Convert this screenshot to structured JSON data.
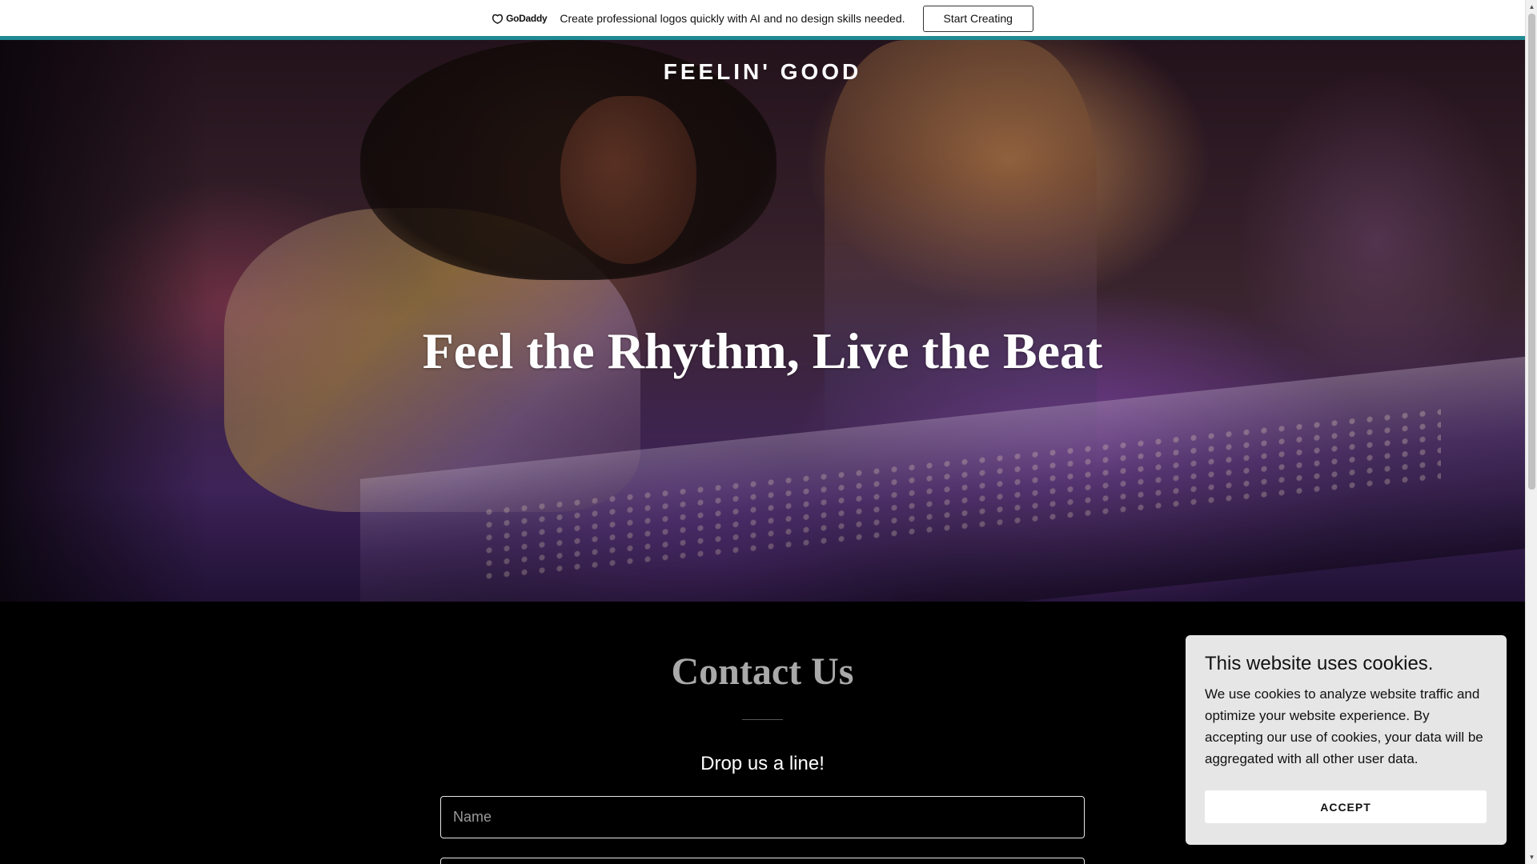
{
  "promo": {
    "logo_text": "GoDaddy",
    "text": "Create professional logos quickly with AI and no design skills needed.",
    "button_label": "Start Creating",
    "accent_color": "#1f8a93"
  },
  "site": {
    "title": "FEELIN' GOOD"
  },
  "hero": {
    "heading": "Feel the Rhythm, Live the Beat"
  },
  "contact": {
    "heading": "Contact Us",
    "subheading": "Drop us a line!",
    "name_placeholder": "Name",
    "email_placeholder": ""
  },
  "cookie": {
    "title": "This website uses cookies.",
    "body": "We use cookies to analyze website traffic and optimize your website experience. By accepting our use of cookies, your data will be aggregated with all other user data.",
    "accept_label": "ACCEPT"
  },
  "scrollbar": {
    "up_icon": "▲",
    "down_icon": "▼"
  }
}
